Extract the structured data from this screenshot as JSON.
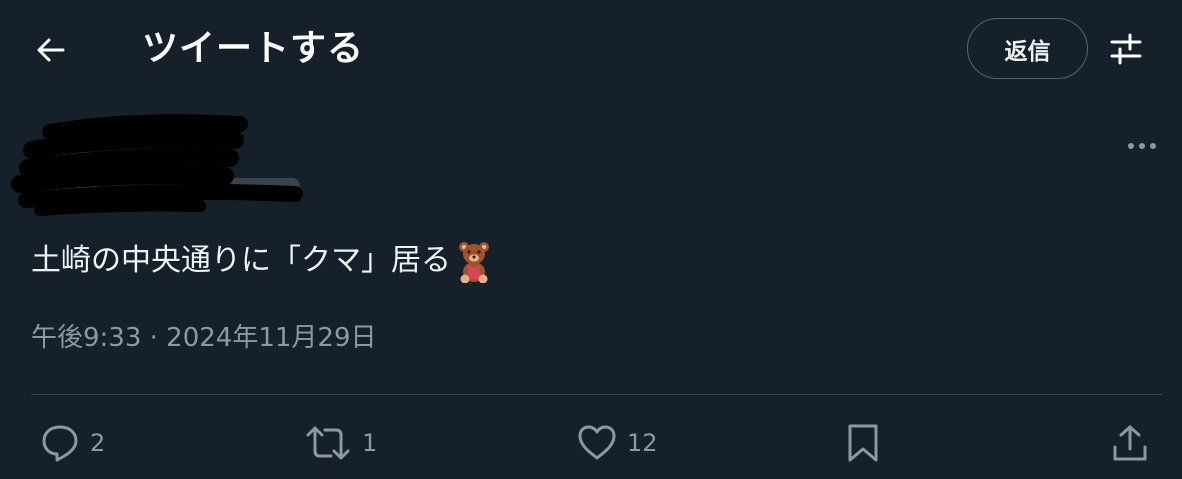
{
  "header": {
    "back_icon": "arrow-left-icon",
    "title": "ツイートする",
    "reply_label": "返信",
    "settings_icon": "sliders-icon"
  },
  "tweet": {
    "text": "土崎の中央通りに「クマ」居る",
    "emoji": "teddy-bear-emoji",
    "timestamp": "午後9:33 · 2024年11月29日",
    "more_icon": "more-horizontal-icon"
  },
  "actions": {
    "reply_count": "2",
    "retweet_count": "1",
    "like_count": "12"
  },
  "colors": {
    "background": "#15202b",
    "text": "#eff3f4",
    "secondary_text": "#8b98a5",
    "divider": "#38444d"
  }
}
